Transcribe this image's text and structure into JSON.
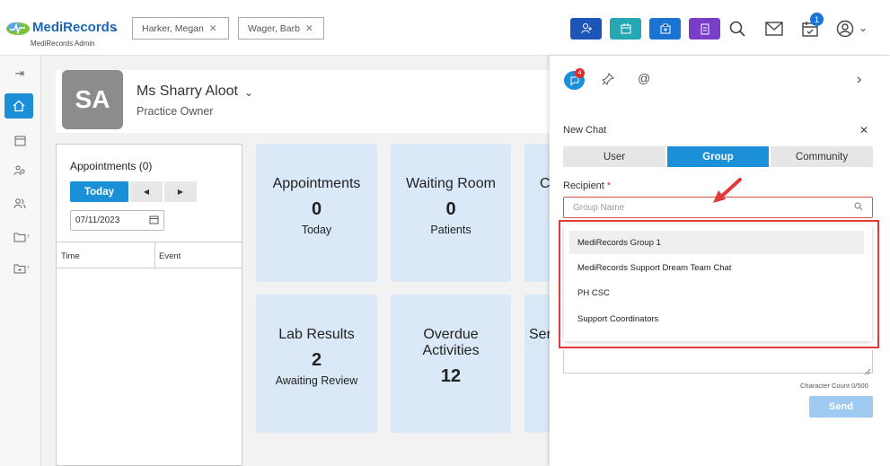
{
  "header": {
    "logo_text": "MediRecords",
    "logo_sub": "MediRecords Admin",
    "tabs": [
      {
        "label": "Harker, Megan"
      },
      {
        "label": "Wager, Barb"
      }
    ],
    "notifications_badge": "1",
    "colors": {
      "btn1": "#1d56b8",
      "btn2": "#25a8b3",
      "btn3": "#1b74d1",
      "btn4": "#7a3dc8"
    }
  },
  "profile": {
    "initials": "SA",
    "name": "Ms Sharry Aloot",
    "role": "Practice Owner"
  },
  "appointments": {
    "title": "Appointments (0)",
    "today_label": "Today",
    "date_value": "07/11/2023",
    "columns": [
      "Time",
      "Event"
    ]
  },
  "tiles": [
    {
      "title": "Appointments",
      "count": "0",
      "sub": "Today"
    },
    {
      "title": "Waiting Room",
      "count": "0",
      "sub": "Patients"
    },
    {
      "title": "Co",
      "count": "",
      "sub": ""
    },
    {
      "title": "Lab Results",
      "count": "2",
      "sub": "Awaiting Review"
    },
    {
      "title": "Overdue Activities",
      "count": "12",
      "sub": ""
    },
    {
      "title": "Ser",
      "count": "",
      "sub": ""
    }
  ],
  "chat": {
    "chat_badge": "4",
    "title": "New Chat",
    "segments": [
      "User",
      "Group",
      "Community"
    ],
    "active_segment": "Group",
    "recipient_label": "Recipient",
    "required_mark": "*",
    "recipient_placeholder": "Group Name",
    "groups": [
      "MediRecords Group 1",
      "MediRecords Support Dream Team Chat",
      "PH CSC",
      "Support Coordinators"
    ],
    "char_count": "Character Count 0/500",
    "send_label": "Send"
  }
}
